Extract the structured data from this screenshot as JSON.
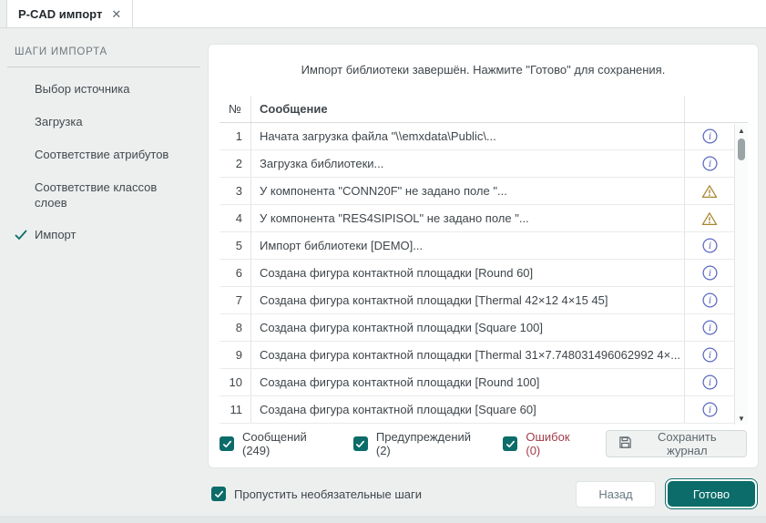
{
  "tab": {
    "title": "P-CAD импорт",
    "close_glyph": "✕"
  },
  "sidebar": {
    "header": "ШАГИ ИМПОРТА",
    "items": [
      {
        "label": "Выбор источника",
        "done": false
      },
      {
        "label": "Загрузка",
        "done": false
      },
      {
        "label": "Соответствие атрибутов",
        "done": false
      },
      {
        "label": "Соответствие классов слоев",
        "done": false
      },
      {
        "label": "Импорт",
        "done": true
      }
    ]
  },
  "main": {
    "status_message": "Импорт библиотеки завершён. Нажмите \"Готово\" для сохранения.",
    "table": {
      "columns": {
        "num": "№",
        "message": "Сообщение"
      },
      "rows": [
        {
          "num": "1",
          "message": "Начата загрузка файла \"\\\\emxdata\\Public\\...",
          "icon": "info"
        },
        {
          "num": "2",
          "message": "Загрузка библиотеки...",
          "icon": "info"
        },
        {
          "num": "3",
          "message": "У компонента \"CONN20F\" не задано поле \"...",
          "icon": "warning"
        },
        {
          "num": "4",
          "message": "У компонента \"RES4SIPISOL\" не задано поле \"...",
          "icon": "warning"
        },
        {
          "num": "5",
          "message": "Импорт библиотеки [DEMO]...",
          "icon": "info"
        },
        {
          "num": "6",
          "message": "Создана фигура контактной площадки [Round 60]",
          "icon": "info"
        },
        {
          "num": "7",
          "message": "Создана фигура контактной площадки [Thermal 42×12 4×15 45]",
          "icon": "info"
        },
        {
          "num": "8",
          "message": "Создана фигура контактной площадки [Square 100]",
          "icon": "info"
        },
        {
          "num": "9",
          "message": "Создана фигура контактной площадки [Thermal 31×7.748031496062992 4×...",
          "icon": "info"
        },
        {
          "num": "10",
          "message": "Создана фигура контактной площадки [Round 100]",
          "icon": "info"
        },
        {
          "num": "11",
          "message": "Создана фигура контактной площадки [Square 60]",
          "icon": "info"
        }
      ]
    },
    "filters": [
      {
        "label": "Сообщений (249)",
        "checked": true,
        "label_color": "#3f464b"
      },
      {
        "label": "Предупреждений (2)",
        "checked": true,
        "label_color": "#3f464b"
      },
      {
        "label": "Ошибок (0)",
        "checked": true,
        "label_color": "#a23c49"
      }
    ],
    "save_log_button": "Сохранить журнал"
  },
  "footer": {
    "skip_label": "Пропустить необязательные шаги",
    "skip_checked": true,
    "back_button": "Назад",
    "finish_button": "Готово"
  },
  "colors": {
    "accent_teal": "#0b6c69",
    "info_icon": "#5b68c0",
    "warning_icon": "#a8862c",
    "error_text": "#a23c49"
  }
}
